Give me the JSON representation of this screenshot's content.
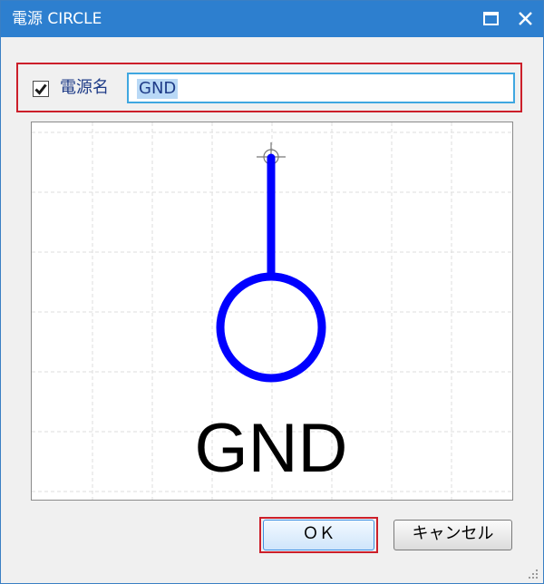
{
  "window": {
    "title": "電源 CIRCLE"
  },
  "name_group": {
    "checked": true,
    "label": "電源名",
    "value": "GND"
  },
  "preview": {
    "symbol_text": "GND",
    "colors": {
      "wire": "#0000ff",
      "grid": "#dcdcdc",
      "text": "#000000"
    }
  },
  "buttons": {
    "ok_label": "ＯＫ",
    "cancel_label": "キャンセル"
  },
  "colors": {
    "titlebar": "#2d7fcf",
    "highlight": "#cc1f2a",
    "input_focus": "#3fa7e0"
  },
  "icons": [
    "maximize-icon",
    "close-icon",
    "checkmark-icon",
    "resize-grip-icon",
    "crosshair-icon"
  ]
}
